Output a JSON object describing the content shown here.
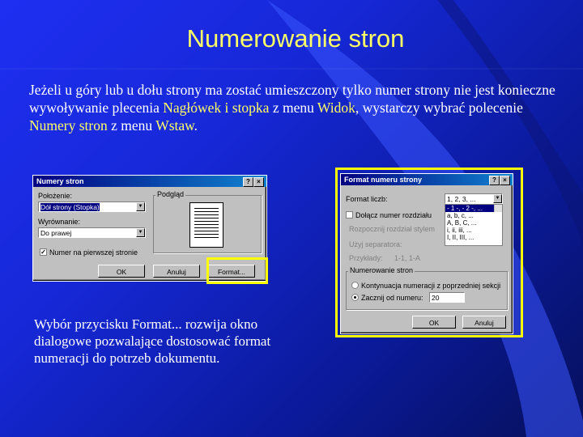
{
  "slide": {
    "title": "Numerowanie stron",
    "body": {
      "part1": "Jeżeli u góry lub u dołu strony ma zostać umieszczony tylko numer strony nie jest konieczne wywoływanie plecenia ",
      "hl1": "Nagłówek i stopka",
      "part2": " z menu ",
      "hl2": "Widok",
      "part3": ", wystarczy wybrać polecenie ",
      "hl3": "Numery stron",
      "part4": " z menu ",
      "hl4": "Wstaw",
      "part5": "."
    },
    "caption": "Wybór przycisku Format... rozwija okno dialogowe pozwalające dostosować format numeracji do potrzeb dokumentu."
  },
  "dialog1": {
    "title": "Numery stron",
    "help_btn": "?",
    "close_btn": "×",
    "position_label": "Położenie:",
    "position_value": "Dół strony (Stopka)",
    "alignment_label": "Wyrównanie:",
    "alignment_value": "Do prawej",
    "preview_label": "Podgląd",
    "first_page_checkbox": "Numer na pierwszej stronie",
    "first_page_checked": "✓",
    "ok": "OK",
    "cancel": "Anuluj",
    "format": "Format..."
  },
  "dialog2": {
    "title": "Format numeru strony",
    "help_btn": "?",
    "close_btn": "×",
    "format_label": "Format liczb:",
    "format_value": "1, 2, 3, ...",
    "format_options": [
      "- 1 -, - 2 -, ...",
      "a, b, c, ...",
      "A, B, C, ...",
      "i, ii, iii, ...",
      "I, II, III, ..."
    ],
    "format_selected_index": 0,
    "include_chapter": "Dołącz numer rozdziału",
    "chapter_start": "Rozpocznij rozdział stylem",
    "separator": "Użyj separatora:",
    "examples_label": "Przykłady:",
    "examples_value": "1-1, 1-A",
    "numbering_group": "Numerowanie stron",
    "continue": "Kontynuacja numeracji z poprzedniej sekcji",
    "start_at": "Zacznij od numeru:",
    "start_value": "20",
    "ok": "OK",
    "cancel": "Anuluj"
  },
  "colors": {
    "title": "#ffff66",
    "highlight": "#ffff66",
    "frame": "#ffff00",
    "background": "#1628d6"
  }
}
